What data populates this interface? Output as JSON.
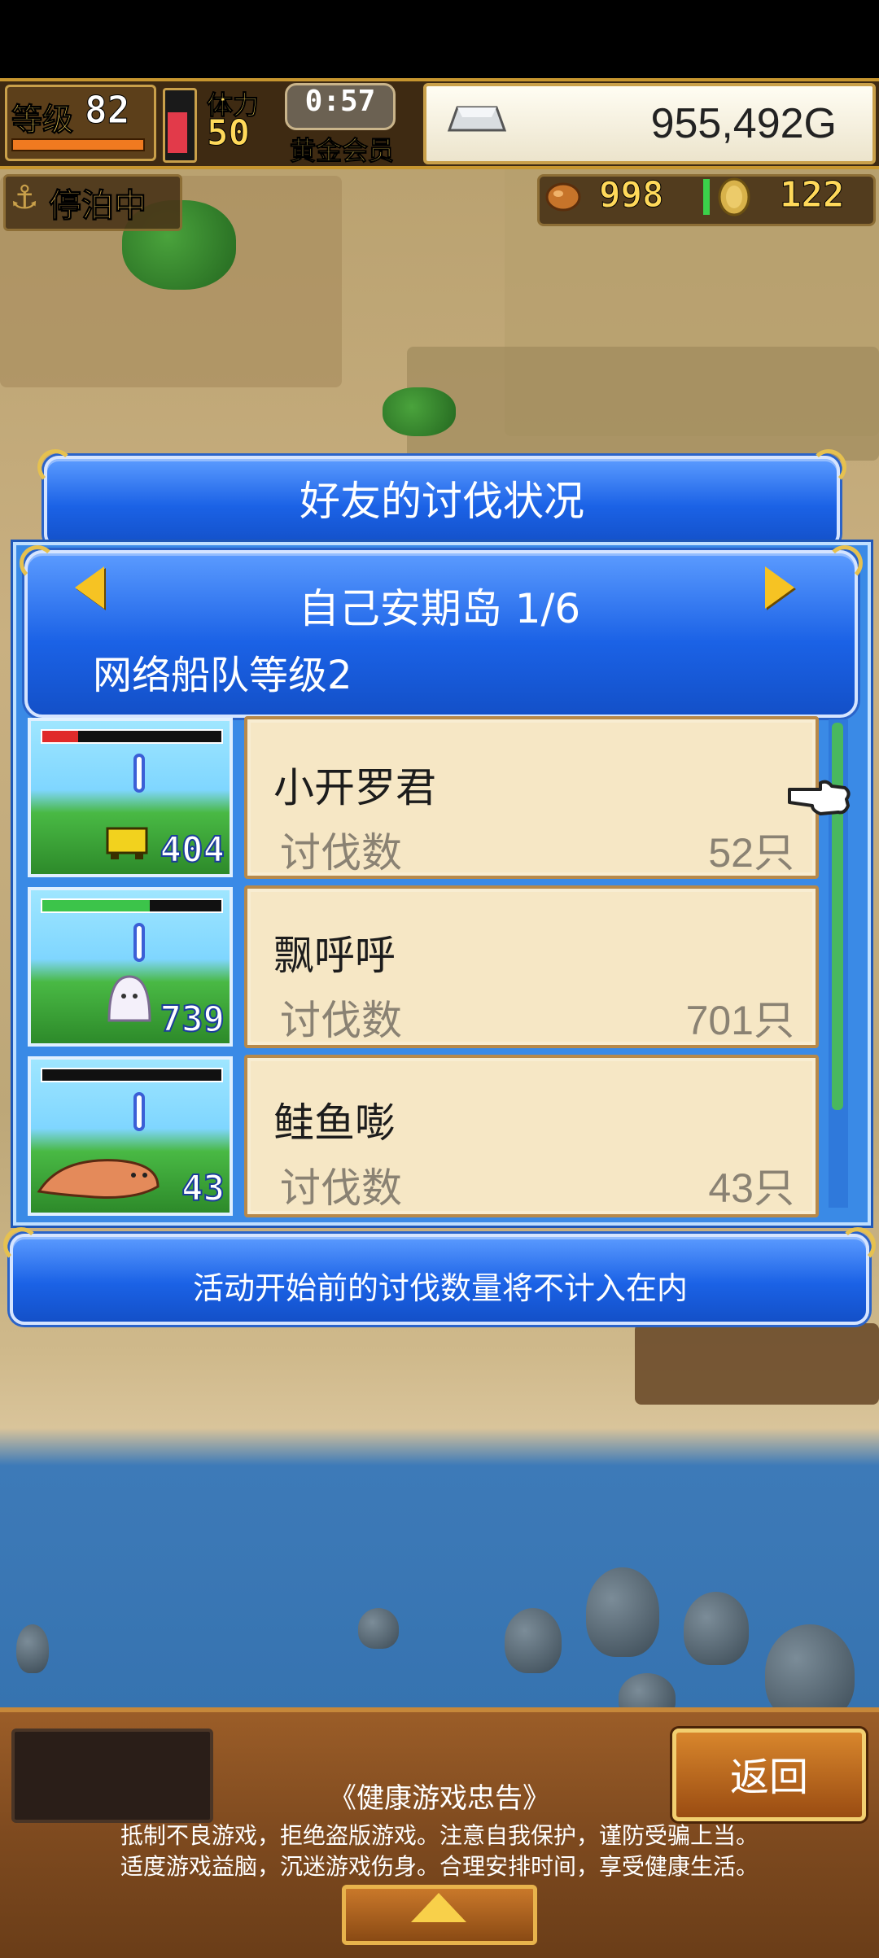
{
  "hud": {
    "level_label": "等级",
    "level_value": "82",
    "stamina_label": "体力",
    "stamina_value": "50",
    "timer": "0:57",
    "member_label": "黄金会员",
    "money": "955,492G",
    "status_label": "停泊中",
    "food_count": "998",
    "medal_count": "122"
  },
  "dialog": {
    "title": "好友的讨伐状况",
    "island_name": "自己安期岛 1/6",
    "fleet_level": "网络船队等级2",
    "rows": [
      {
        "name": "小开罗君",
        "label": "讨伐数",
        "count": "52只",
        "badge": "404",
        "hp": 0.2,
        "hp_color": "#e02a2a",
        "monster": "yellow-dog-icon"
      },
      {
        "name": "飘呼呼",
        "label": "讨伐数",
        "count": "701只",
        "badge": "739",
        "hp": 0.6,
        "hp_color": "#3cc44a",
        "monster": "white-ghost-icon"
      },
      {
        "name": "鲑鱼嘭",
        "label": "讨伐数",
        "count": "43只",
        "badge": "43",
        "hp": 0.0,
        "hp_color": "#3cc44a",
        "monster": "salmon-fish-icon"
      }
    ],
    "note": "活动开始前的讨伐数量将不计入在内"
  },
  "footer": {
    "back_label": "返回",
    "health_title": "《健康游戏忠告》",
    "health_line1": "抵制不良游戏，拒绝盗版游戏。注意自我保护，谨防受骗上当。",
    "health_line2": "适度游戏益脑，沉迷游戏伤身。合理安排时间，享受健康生活。"
  },
  "colors": {
    "accent_blue": "#1b62e6",
    "gold": "#f6c323",
    "card_bg": "#f6e7c5"
  }
}
